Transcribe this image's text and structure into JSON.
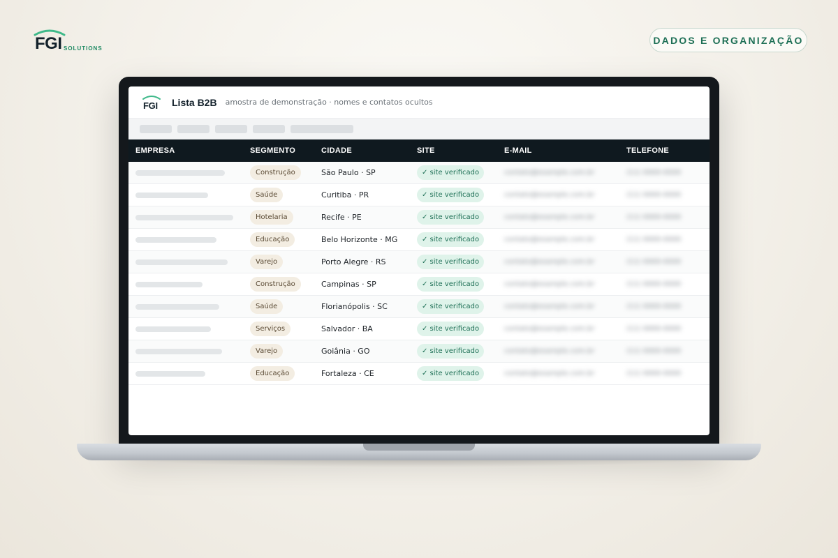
{
  "brand": {
    "mark": "FGI",
    "sub": "SOLUTIONS",
    "accent_color": "#3fb98a"
  },
  "category_pill": "DADOS E ORGANIZAÇÃO",
  "app": {
    "logo": "FGI",
    "title": "Lista B2B",
    "subtitle": "amostra de demonstração · nomes e contatos ocultos"
  },
  "table": {
    "headers": {
      "empresa": "EMPRESA",
      "segmento": "SEGMENTO",
      "cidade": "CIDADE",
      "site": "SITE",
      "email": "E-MAIL",
      "telefone": "TELEFONE"
    },
    "rows": [
      {
        "segmento": "Construção",
        "cidade": "São Paulo · SP",
        "site": "✓ site verificado",
        "email": "contato@example.com.br",
        "telefone": "(11) 0000-0000"
      },
      {
        "segmento": "Saúde",
        "cidade": "Curitiba · PR",
        "site": "✓ site verificado",
        "email": "contato@example.com.br",
        "telefone": "(11) 0000-0000"
      },
      {
        "segmento": "Hotelaria",
        "cidade": "Recife · PE",
        "site": "✓ site verificado",
        "email": "contato@example.com.br",
        "telefone": "(11) 0000-0000"
      },
      {
        "segmento": "Educação",
        "cidade": "Belo Horizonte · MG",
        "site": "✓ site verificado",
        "email": "contato@example.com.br",
        "telefone": "(11) 0000-0000"
      },
      {
        "segmento": "Varejo",
        "cidade": "Porto Alegre · RS",
        "site": "✓ site verificado",
        "email": "contato@example.com.br",
        "telefone": "(11) 0000-0000"
      },
      {
        "segmento": "Construção",
        "cidade": "Campinas · SP",
        "site": "✓ site verificado",
        "email": "contato@example.com.br",
        "telefone": "(11) 0000-0000"
      },
      {
        "segmento": "Saúde",
        "cidade": "Florianópolis · SC",
        "site": "✓ site verificado",
        "email": "contato@example.com.br",
        "telefone": "(11) 0000-0000"
      },
      {
        "segmento": "Serviços",
        "cidade": "Salvador · BA",
        "site": "✓ site verificado",
        "email": "contato@example.com.br",
        "telefone": "(11) 0000-0000"
      },
      {
        "segmento": "Varejo",
        "cidade": "Goiânia · GO",
        "site": "✓ site verificado",
        "email": "contato@example.com.br",
        "telefone": "(11) 0000-0000"
      },
      {
        "segmento": "Educação",
        "cidade": "Fortaleza · CE",
        "site": "✓ site verificado",
        "email": "contato@example.com.br",
        "telefone": "(11) 0000-0000"
      }
    ]
  }
}
